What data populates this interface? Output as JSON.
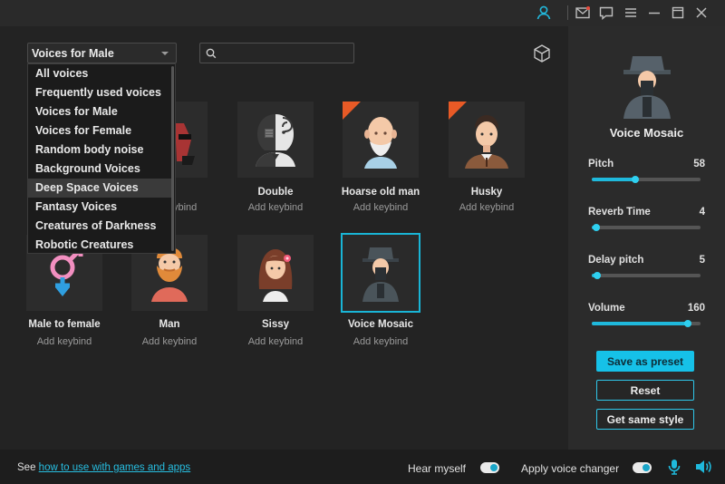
{
  "titlebar": {
    "icons": [
      "user-icon",
      "mail-icon",
      "chat-icon",
      "menu-icon",
      "minimize-icon",
      "maximize-icon",
      "close-icon"
    ],
    "accent": "#19b5d6"
  },
  "filter": {
    "selected": "Voices for Male",
    "options": [
      "All voices",
      "Frequently used voices",
      "Voices for Male",
      "Voices for Female",
      "Random body noise",
      "Background Voices",
      "Deep Space Voices",
      "Fantasy Voices",
      "Creatures of Darkness",
      "Robotic Creatures"
    ],
    "highlighted": "Deep Space Voices"
  },
  "search": {
    "value": "",
    "placeholder": ""
  },
  "voices": [
    {
      "name": "",
      "keybind": "Add keybind",
      "new": false
    },
    {
      "name": "Double",
      "keybind": "Add keybind",
      "new": false
    },
    {
      "name": "Hoarse old man",
      "keybind": "Add keybind",
      "new": true
    },
    {
      "name": "Husky",
      "keybind": "Add keybind",
      "new": true
    },
    {
      "name": "Male to female",
      "keybind": "Add keybind",
      "new": false
    },
    {
      "name": "Man",
      "keybind": "Add keybind",
      "new": false
    },
    {
      "name": "Sissy",
      "keybind": "Add keybind",
      "new": false
    },
    {
      "name": "Voice Mosaic",
      "keybind": "Add keybind",
      "new": false,
      "selected": true
    }
  ],
  "badge_new": "NEW",
  "panel": {
    "title": "Voice Mosaic",
    "sliders": [
      {
        "label": "Pitch",
        "value": "58",
        "fraction": 0.4
      },
      {
        "label": "Reverb Time",
        "value": "4",
        "fraction": 0.04
      },
      {
        "label": "Delay pitch",
        "value": "5",
        "fraction": 0.05
      },
      {
        "label": "Volume",
        "value": "160",
        "fraction": 0.88
      }
    ],
    "save_label": "Save as preset",
    "reset_label": "Reset",
    "style_label": "Get same style"
  },
  "bottom": {
    "see_text": "See",
    "link_text": "how to use with games and apps",
    "hear_label": "Hear myself",
    "hear_on": true,
    "apply_label": "Apply voice changer",
    "apply_on": true
  }
}
